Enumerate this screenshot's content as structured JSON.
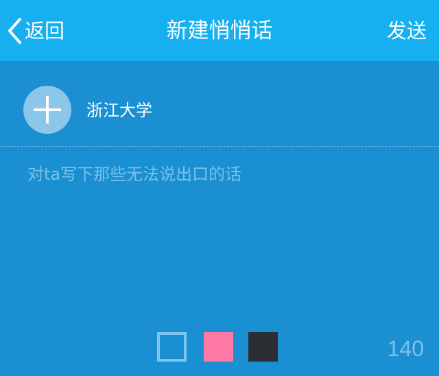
{
  "navbar": {
    "back_label": "返回",
    "title": "新建悄悄话",
    "send_label": "发送",
    "background": "#16b0f0"
  },
  "target": {
    "name": "浙江大学",
    "add_icon": "plus-icon"
  },
  "message": {
    "placeholder": "对ta写下那些无法说出口的话",
    "value": ""
  },
  "colors": {
    "background": "#1a8fd1",
    "options": [
      {
        "name": "blue",
        "color": "#1a8fd1",
        "selected": true
      },
      {
        "name": "pink",
        "color": "#ff79a4",
        "selected": false
      },
      {
        "name": "dark",
        "color": "#2a2f33",
        "selected": false
      }
    ]
  },
  "counter": {
    "remaining": "140"
  }
}
